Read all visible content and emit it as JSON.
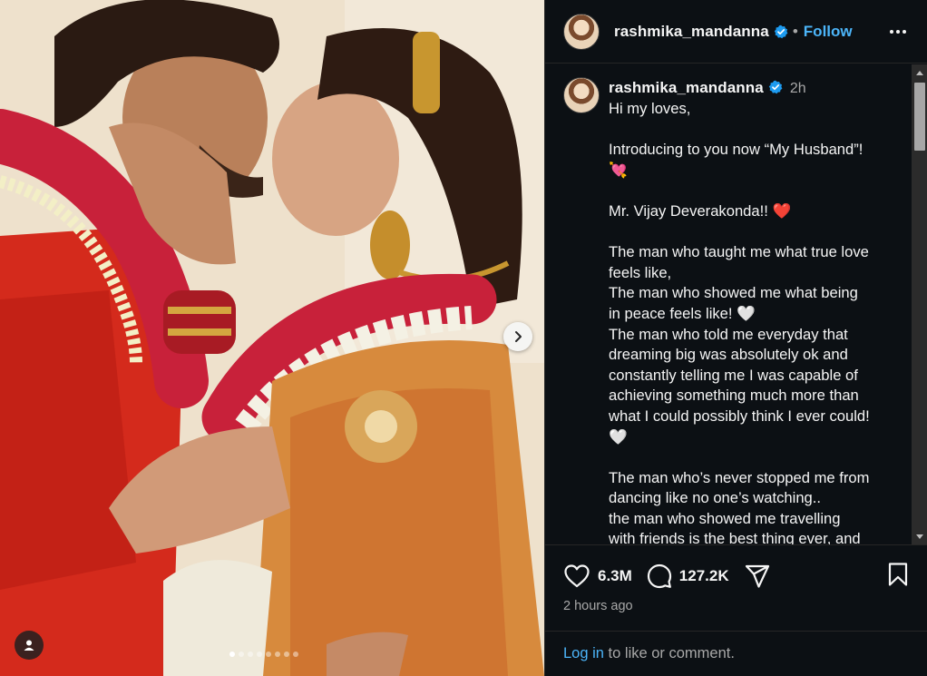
{
  "post": {
    "username": "rashmika_mandanna",
    "separator": "•",
    "follow_label": "Follow",
    "time_ago": "2h",
    "image_alt": "Wedding photo",
    "carousel": {
      "total": 8,
      "active_index": 0
    }
  },
  "caption": {
    "lines": [
      "Hi my loves,",
      "",
      "Introducing to you now “My Husband”!",
      "💘",
      "",
      "Mr. Vijay Deverakonda!! ❤️",
      "",
      "The man who taught me what true love",
      "feels like,",
      "The man who showed me what being",
      "in peace feels like! 🤍",
      "The man who told me everyday that",
      "dreaming big was absolutely ok and",
      "constantly telling me I was capable of",
      "achieving something much more than",
      "what I could possibly think I ever could!",
      "🤍",
      "",
      "The man who’s never stopped me from",
      "dancing like no one’s watching..",
      "the man who showed me travelling",
      "with friends is the best thing ever, and"
    ]
  },
  "stats": {
    "likes": "6.3M",
    "comments": "127.2K",
    "posted_ago": "2 hours ago"
  },
  "footer": {
    "login_label": "Log in",
    "rest": " to like or comment."
  },
  "icons": {
    "verified": "verified-badge-icon",
    "more": "more-options-icon",
    "like": "heart-icon",
    "comment": "comment-icon",
    "share": "share-icon",
    "save": "bookmark-icon",
    "next": "chevron-right-icon",
    "tags": "user-tag-icon"
  },
  "colors": {
    "link": "#4cb5f9",
    "verified": "#1d9bf0",
    "panel_bg": "#0c1014"
  }
}
